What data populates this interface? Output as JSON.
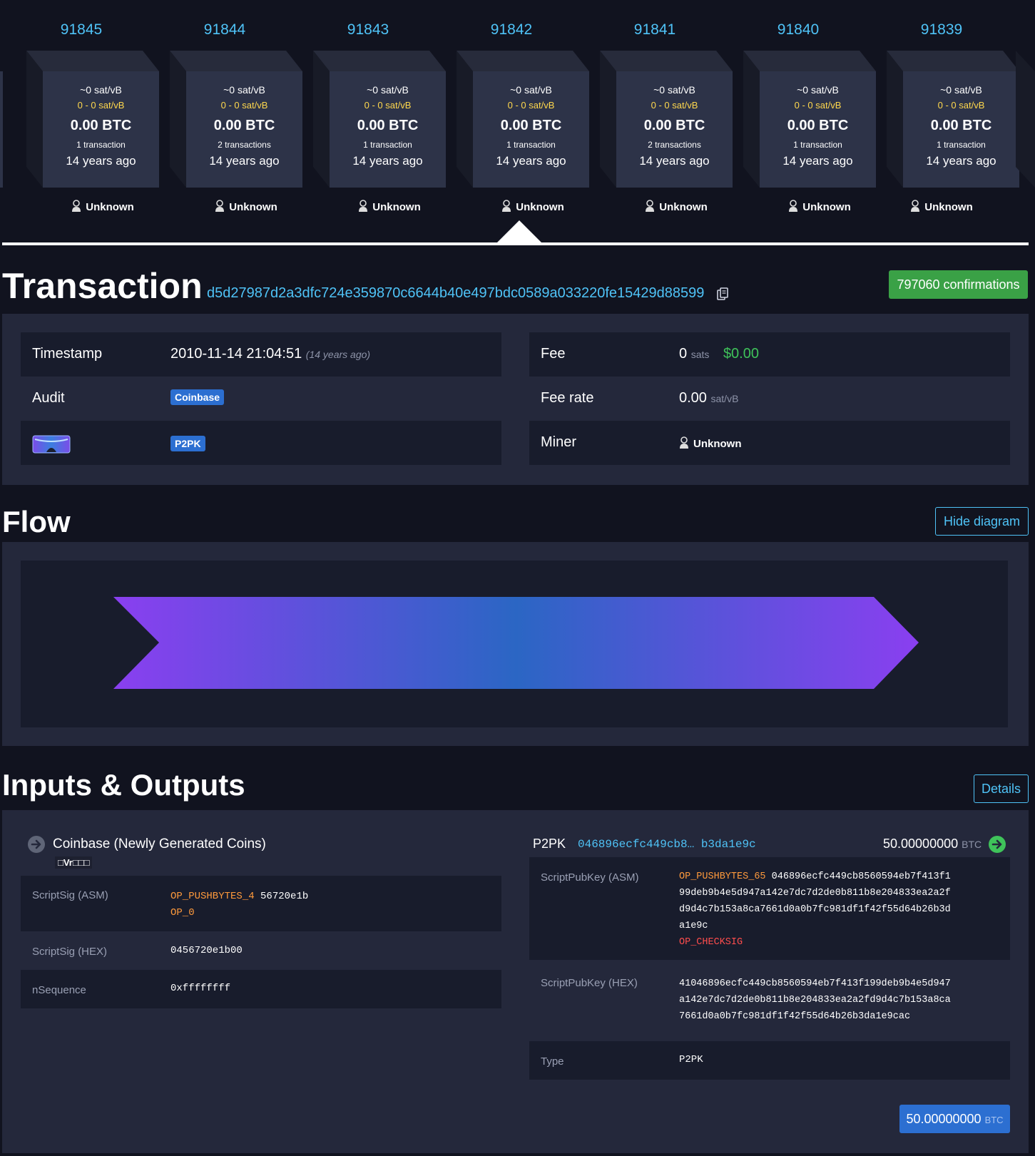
{
  "blocks": [
    {
      "height": "91845",
      "median_fee": "~0 sat/vB",
      "fee_range": "0 - 0 sat/vB",
      "total": "0.00 BTC",
      "tx_count": "1 transaction",
      "age": "14 years ago",
      "miner": "Unknown"
    },
    {
      "height": "91844",
      "median_fee": "~0 sat/vB",
      "fee_range": "0 - 0 sat/vB",
      "total": "0.00 BTC",
      "tx_count": "2 transactions",
      "age": "14 years ago",
      "miner": "Unknown"
    },
    {
      "height": "91843",
      "median_fee": "~0 sat/vB",
      "fee_range": "0 - 0 sat/vB",
      "total": "0.00 BTC",
      "tx_count": "1 transaction",
      "age": "14 years ago",
      "miner": "Unknown"
    },
    {
      "height": "91842",
      "median_fee": "~0 sat/vB",
      "fee_range": "0 - 0 sat/vB",
      "total": "0.00 BTC",
      "tx_count": "1 transaction",
      "age": "14 years ago",
      "miner": "Unknown"
    },
    {
      "height": "91841",
      "median_fee": "~0 sat/vB",
      "fee_range": "0 - 0 sat/vB",
      "total": "0.00 BTC",
      "tx_count": "2 transactions",
      "age": "14 years ago",
      "miner": "Unknown"
    },
    {
      "height": "91840",
      "median_fee": "~0 sat/vB",
      "fee_range": "0 - 0 sat/vB",
      "total": "0.00 BTC",
      "tx_count": "1 transaction",
      "age": "14 years ago",
      "miner": "Unknown"
    },
    {
      "height": "91839",
      "median_fee": "~0 sat/vB",
      "fee_range": "0 - 0 sat/vB",
      "total": "0.00 BTC",
      "tx_count": "1 transaction",
      "age": "14 years ago",
      "miner": "Unknown"
    }
  ],
  "transaction": {
    "title": "Transaction",
    "txid": "d5d27987d2a3dfc724e359870c6644b40e497bdc0589a033220fe15429d88599",
    "confirmations": "797060 confirmations",
    "timestamp_label": "Timestamp",
    "timestamp": "2010-11-14 21:04:51",
    "timestamp_relative": "(14 years ago)",
    "audit_label": "Audit",
    "audit_tag": "Coinbase",
    "type_tag": "P2PK",
    "fee_label": "Fee",
    "fee_value": "0",
    "fee_unit": "sats",
    "fee_usd": "$0.00",
    "fee_rate_label": "Fee rate",
    "fee_rate_value": "0.00",
    "fee_rate_unit": "sat/vB",
    "miner_label": "Miner",
    "miner_value": "Unknown"
  },
  "flow": {
    "title": "Flow",
    "toggle_button": "Hide diagram"
  },
  "io": {
    "title": "Inputs & Outputs",
    "details_button": "Details",
    "input": {
      "title": "Coinbase (Newly Generated Coins)",
      "coinbase_text": "□Vr□□□",
      "scriptsig_asm_label": "ScriptSig (ASM)",
      "scriptsig_asm_op1": "OP_PUSHBYTES_4",
      "scriptsig_asm_data": "56720e1b",
      "scriptsig_asm_op2": "OP_0",
      "scriptsig_hex_label": "ScriptSig (HEX)",
      "scriptsig_hex": "0456720e1b00",
      "nsequence_label": "nSequence",
      "nsequence": "0xffffffff"
    },
    "output": {
      "type_label": "P2PK",
      "pubkey_short": "046896ecfc449cb8… b3da1e9c",
      "amount": "50.00000000",
      "amount_unit": "BTC",
      "spk_asm_label": "ScriptPubKey (ASM)",
      "spk_asm_op1": "OP_PUSHBYTES_65",
      "spk_asm_line1": "046896ecfc449cb8560594eb7f413f1",
      "spk_asm_line2": "99deb9b4e5d947a142e7dc7d2de0b811b8e204833ea2a2f",
      "spk_asm_line3": "d9d4c7b153a8ca7661d0a0b7fc981df1f42f55d64b26b3d",
      "spk_asm_line4": "a1e9c",
      "spk_asm_op2": "OP_CHECKSIG",
      "spk_hex_label": "ScriptPubKey (HEX)",
      "spk_hex_line1": "41046896ecfc449cb8560594eb7f413f199deb9b4e5d947",
      "spk_hex_line2": "a142e7dc7d2de0b811b8e204833ea2a2fd9d4c7b153a8ca",
      "spk_hex_line3": "7661d0a0b7fc981df1f42f55d64b26b3da1e9cac",
      "type_row_label": "Type",
      "type_row_value": "P2PK"
    },
    "total_amount": "50.00000000",
    "total_unit": "BTC"
  },
  "colors": {
    "accent": "#4fc3f7",
    "confirm": "#3aa146",
    "fee_range": "#ffd84d",
    "flow_start": "#8a3ff0",
    "flow_mid": "#2b66c4"
  }
}
